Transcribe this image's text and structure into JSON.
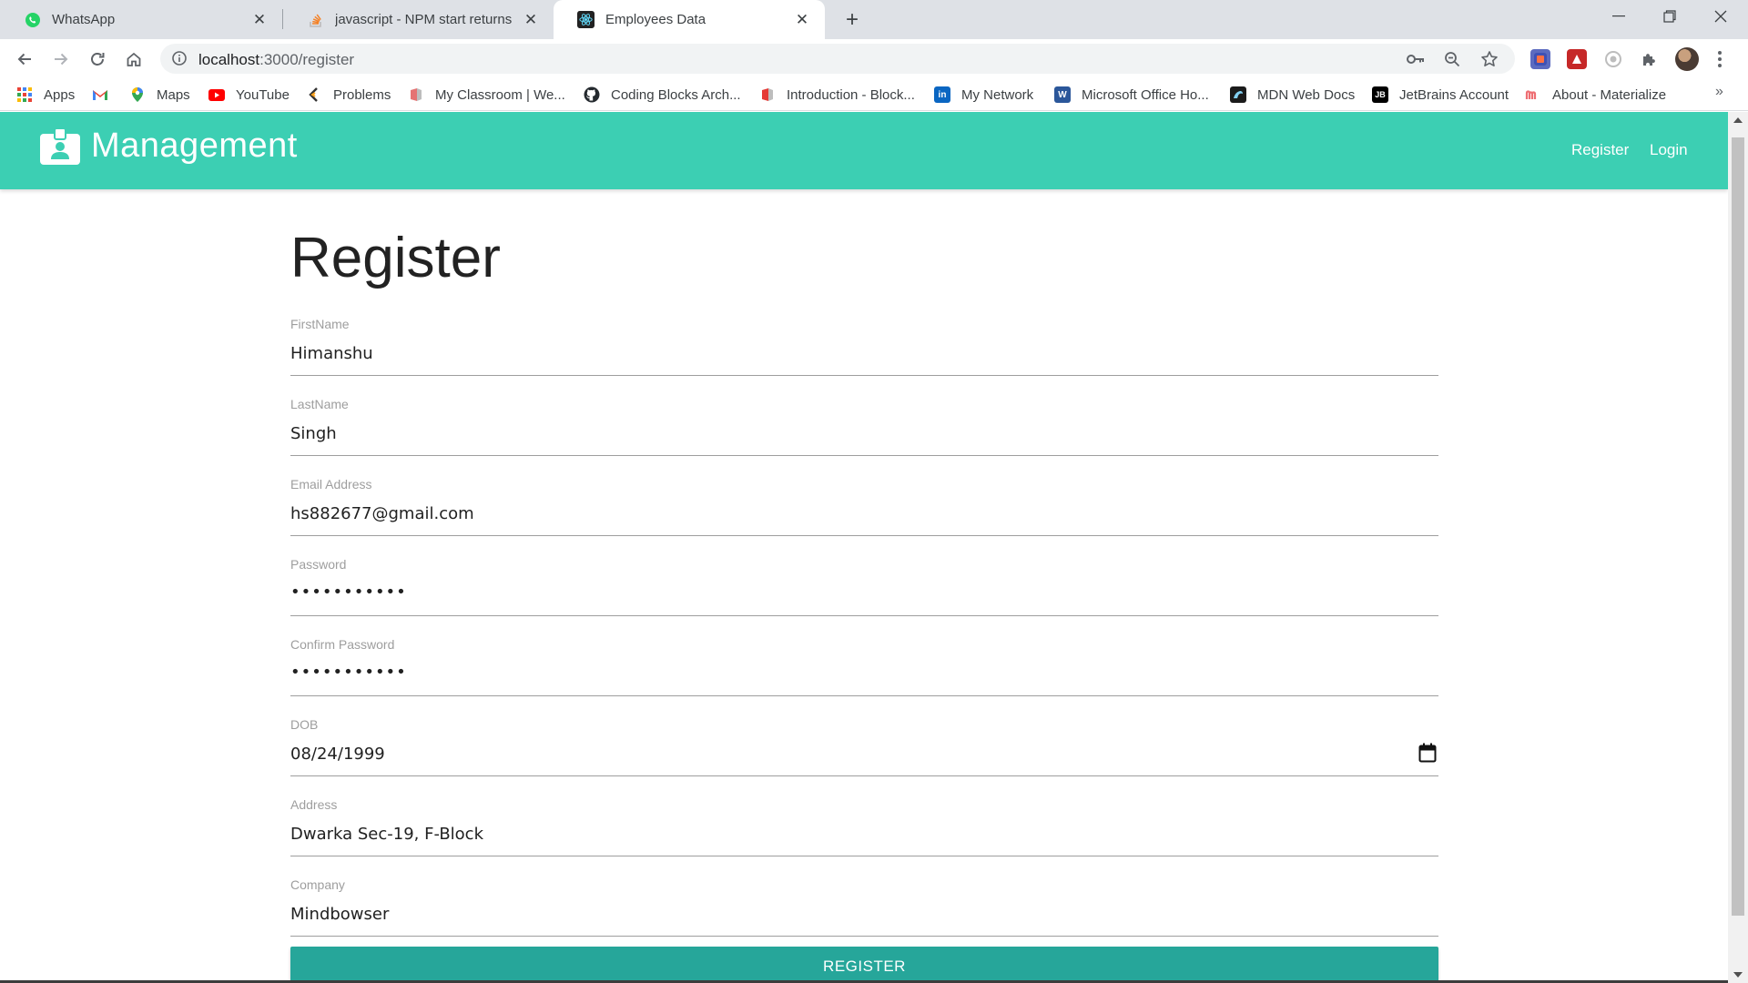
{
  "browser": {
    "tabs": [
      {
        "title": "WhatsApp",
        "icon": "whatsapp-icon",
        "active": false
      },
      {
        "title": "javascript - NPM start returns err",
        "icon": "stackoverflow-icon",
        "active": false
      },
      {
        "title": "Employees Data",
        "icon": "react-icon",
        "active": true
      }
    ],
    "url_host": "localhost",
    "url_path": ":3000/register",
    "bookmarks": [
      {
        "label": "Apps",
        "icon": "apps-grid-icon"
      },
      {
        "label": "",
        "icon": "gmail-icon"
      },
      {
        "label": "Maps",
        "icon": "maps-icon"
      },
      {
        "label": "YouTube",
        "icon": "youtube-icon"
      },
      {
        "label": "Problems",
        "icon": "problems-icon"
      },
      {
        "label": "My Classroom | We...",
        "icon": "classroom-icon"
      },
      {
        "label": "Coding Blocks Arch...",
        "icon": "github-icon"
      },
      {
        "label": "Introduction - Block...",
        "icon": "block-icon"
      },
      {
        "label": "My Network",
        "icon": "linkedin-icon"
      },
      {
        "label": "Microsoft Office Ho...",
        "icon": "word-icon"
      },
      {
        "label": "MDN Web Docs",
        "icon": "mdn-icon"
      },
      {
        "label": "JetBrains Account",
        "icon": "jetbrains-icon"
      },
      {
        "label": "About - Materialize",
        "icon": "materialize-icon"
      }
    ],
    "bookmarks_overflow": "»"
  },
  "app": {
    "brand": "Management",
    "nav": {
      "register": "Register",
      "login": "Login"
    },
    "accent_color": "#3ccfb3",
    "button_color": "#26a69a"
  },
  "form": {
    "title": "Register",
    "fields": [
      {
        "label": "FirstName",
        "value": "Himanshu"
      },
      {
        "label": "LastName",
        "value": "Singh"
      },
      {
        "label": "Email Address",
        "value": "hs882677@gmail.com"
      },
      {
        "label": "Password",
        "value": "•••••••••••"
      },
      {
        "label": "Confirm Password",
        "value": "•••••••••••"
      },
      {
        "label": "DOB",
        "value": "08/24/1999"
      },
      {
        "label": "Address",
        "value": "Dwarka Sec-19, F-Block"
      },
      {
        "label": "Company",
        "value": "Mindbowser"
      }
    ],
    "submit_label": "REGISTER"
  }
}
